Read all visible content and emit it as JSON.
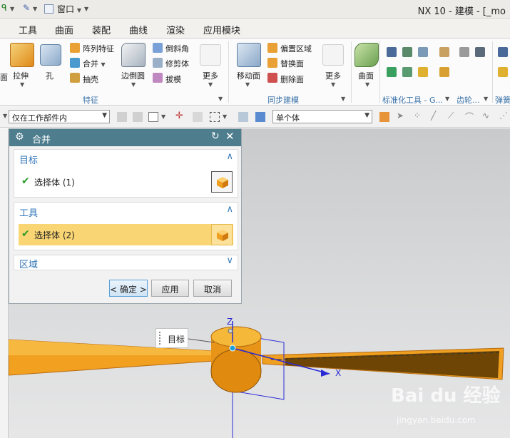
{
  "titlebar": {
    "window_menu_label": "窗口",
    "title": "NX 10 - 建模 - [_mo"
  },
  "menu": {
    "tabs": [
      "工具",
      "曲面",
      "装配",
      "曲线",
      "渲染",
      "应用模块"
    ]
  },
  "ribbon": {
    "features": {
      "extrude": "拉伸",
      "hole": "孔",
      "pattern_feature": "阵列特征",
      "unite": "合并",
      "shell": "抽壳",
      "edge_blend": "边倒圆",
      "chamfer": "倒斜角",
      "trim_body": "修剪体",
      "draft": "拔模",
      "more": "更多",
      "group_label": "特征"
    },
    "sync": {
      "move_face": "移动面",
      "offset_region": "偏置区域",
      "replace_face": "替换面",
      "delete_face": "删除面",
      "more": "更多",
      "group_label": "同步建模"
    },
    "surface": {
      "surface": "曲面"
    },
    "standard_tools_label": "标准化工具 - G...",
    "gear_label": "齿轮...",
    "spring_label": "弹簧",
    "left_cut_label": "面"
  },
  "filterbar": {
    "scope": "仅在工作部件内",
    "body_type": "单个体"
  },
  "dialog": {
    "title": "合并",
    "target": {
      "title": "目标",
      "row_label": "选择体 (1)"
    },
    "tool": {
      "title": "工具",
      "row_label": "选择体 (2)"
    },
    "region": {
      "title": "区域"
    },
    "buttons": {
      "ok": "< 确定 >",
      "apply": "应用",
      "cancel": "取消"
    }
  },
  "viewport": {
    "target_tag": "目标",
    "axis_z": "Z",
    "axis_x": "X",
    "watermark": "Bai du 经验",
    "watermark_url": "jingyan.baidu.com"
  },
  "colors": {
    "dialog_header": "#4e7d8e",
    "section_title": "#3377b8",
    "active_row": "#fad574",
    "model_orange": "#f0a020"
  }
}
